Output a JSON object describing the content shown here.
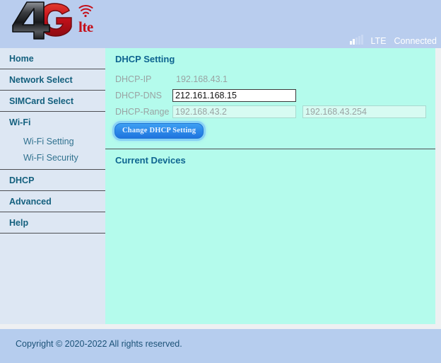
{
  "header": {
    "logo": {
      "primary_text": "4",
      "secondary_text": "G",
      "suffix_text": "lte",
      "primary_color": "#2c2c2c",
      "secondary_color": "#cc1111",
      "background": "#b9cdee"
    },
    "status": {
      "signal_icon": "signal-bars-icon",
      "signal_bars_total": 5,
      "signal_bars_active": 2,
      "network_type": "LTE",
      "connection_state": "Connected"
    }
  },
  "sidebar": {
    "items": [
      {
        "label": "Home",
        "type": "top"
      },
      {
        "label": "Network Select",
        "type": "top"
      },
      {
        "label": "SIMCard Select",
        "type": "top"
      },
      {
        "label": "Wi-Fi",
        "type": "top"
      },
      {
        "label": "Wi-Fi Setting",
        "type": "sub"
      },
      {
        "label": "Wi-Fi Security",
        "type": "sub"
      },
      {
        "label": "DHCP",
        "type": "top"
      },
      {
        "label": "Advanced",
        "type": "top"
      },
      {
        "label": "Help",
        "type": "top"
      }
    ]
  },
  "main": {
    "dhcp_setting": {
      "title": "DHCP Setting",
      "rows": {
        "ip": {
          "label": "DHCP-IP",
          "value": "192.168.43.1"
        },
        "dns": {
          "label": "DHCP-DNS",
          "value": "212.161.168.15",
          "placeholder": ""
        },
        "range": {
          "label": "DHCP-Range",
          "start_value": "192.168.43.2",
          "end_value": "192.168.43.254",
          "start_placeholder": "",
          "end_placeholder": ""
        }
      },
      "submit_label": "Change DHCP Setting"
    },
    "current_devices": {
      "title": "Current Devices"
    }
  },
  "footer": {
    "copyright": "Copyright © 2020-2022  All rights reserved."
  },
  "colors": {
    "header_bg": "#b9cdee",
    "sidebar_bg": "#dde7f3",
    "main_bg": "#b4fbec",
    "footer_bg": "#b6cdee",
    "accent_title": "#0e6490",
    "nav_link": "#14607e",
    "button_blue": "#2e8bea"
  }
}
